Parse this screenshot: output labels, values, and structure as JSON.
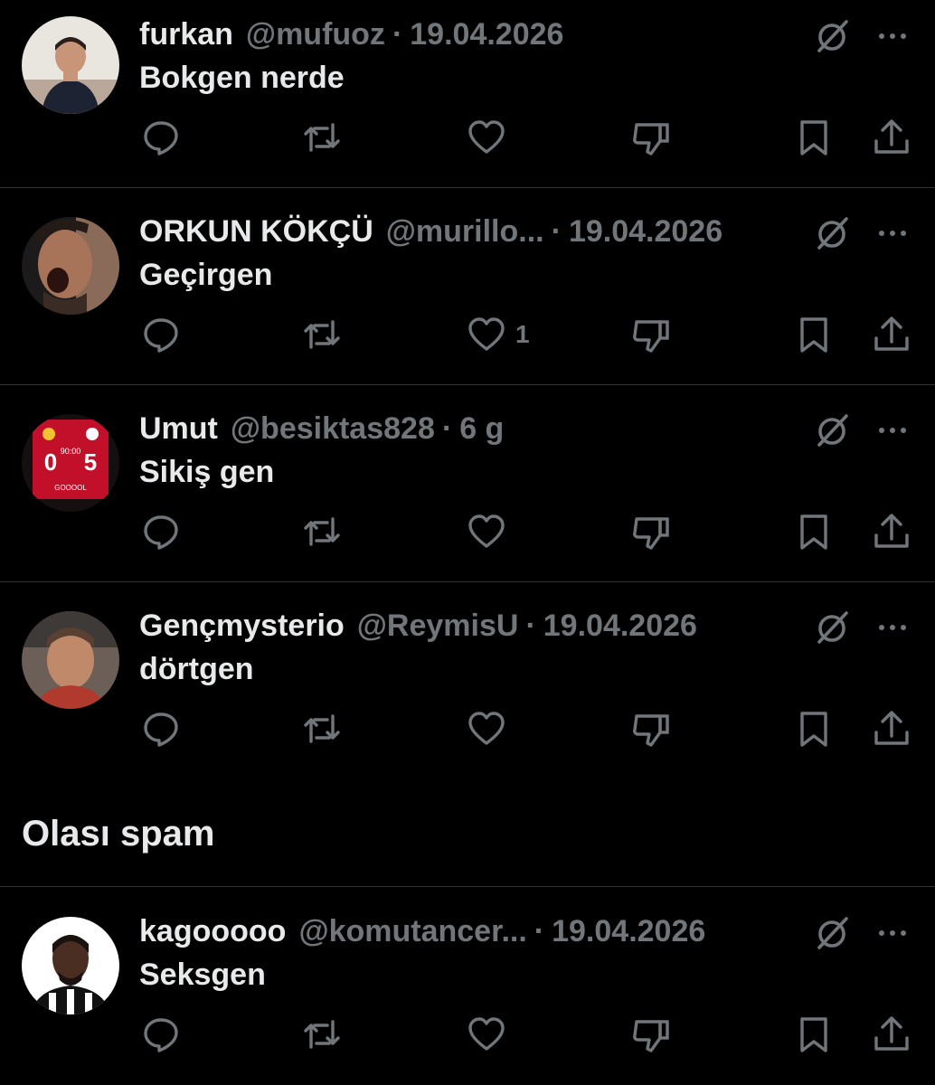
{
  "replies": [
    {
      "name": "furkan",
      "handle": "@mufuoz",
      "time": "19.04.2026",
      "text": "Bokgen nerde",
      "likes": "",
      "avatar": "child-photo-avatar"
    },
    {
      "name": "ORKUN KÖKÇÜ",
      "handle": "@murillo...",
      "time": "19.04.2026",
      "text": "Geçirgen",
      "likes": "1",
      "avatar": "footballer-shouting-avatar"
    },
    {
      "name": "Umut",
      "handle": "@besiktas828",
      "time": "6 g",
      "text": "Sikiş gen",
      "likes": "",
      "avatar": "scoreboard-avatar"
    },
    {
      "name": "Gençmysterio",
      "handle": "@ReymisU",
      "time": "19.04.2026",
      "text": "dörtgen",
      "likes": "",
      "avatar": "man-portrait-avatar"
    },
    {
      "name": "kagooooo",
      "handle": "@komutancer...",
      "time": "19.04.2026",
      "text": "Seksgen",
      "likes": "",
      "avatar": "player-portrait-avatar"
    }
  ],
  "spam_section": {
    "title": "Olası spam"
  },
  "scoreboard": {
    "score_left": "0",
    "score_right": "5",
    "clock": "90:00",
    "word": "GOOOOL"
  },
  "colors": {
    "background": "#000000",
    "text_primary": "#e7e9ea",
    "text_secondary": "#71767b",
    "divider": "#2f3336"
  },
  "icons": [
    "reply-icon",
    "retweet-icon",
    "like-icon",
    "dislike-icon",
    "bookmark-icon",
    "share-icon",
    "grok-icon",
    "more-icon"
  ]
}
